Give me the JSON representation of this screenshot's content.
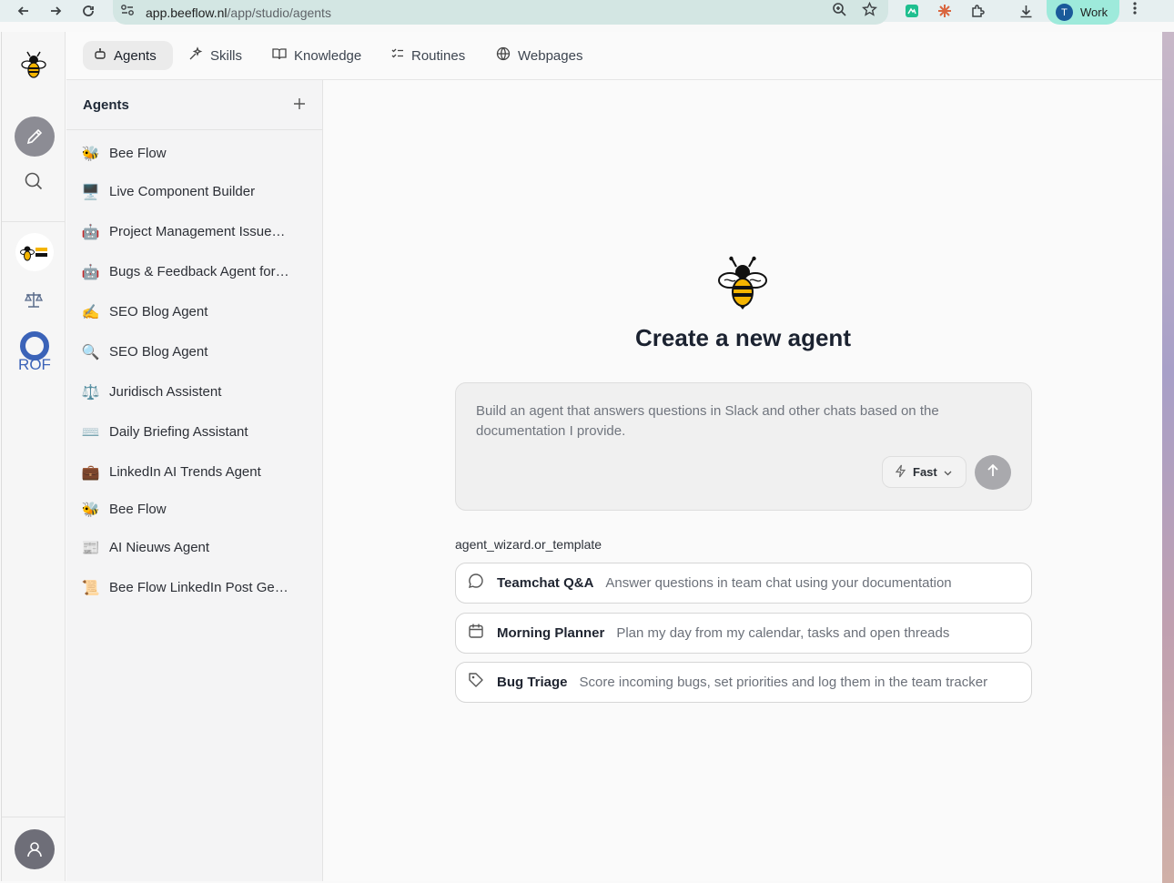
{
  "browser": {
    "url_host": "app.beeflow.nl",
    "url_path": "/app/studio/agents",
    "profile_initial": "T",
    "profile_label": "Work"
  },
  "tabs": [
    {
      "label": "Agents",
      "icon": "bot-icon",
      "active": true
    },
    {
      "label": "Skills",
      "icon": "sparkle-icon"
    },
    {
      "label": "Knowledge",
      "icon": "book-icon"
    },
    {
      "label": "Routines",
      "icon": "checklist-icon"
    },
    {
      "label": "Webpages",
      "icon": "globe-icon"
    }
  ],
  "agent_panel": {
    "title": "Agents",
    "items": [
      {
        "emoji": "🐝",
        "label": "Bee Flow"
      },
      {
        "emoji": "🖥️",
        "label": "Live Component Builder"
      },
      {
        "emoji": "🤖",
        "label": "Project Management Issue…"
      },
      {
        "emoji": "🤖",
        "label": "Bugs & Feedback Agent for…"
      },
      {
        "emoji": "✍️",
        "label": "SEO Blog Agent"
      },
      {
        "emoji": "🔍",
        "label": "SEO Blog Agent"
      },
      {
        "emoji": "⚖️",
        "label": "Juridisch Assistent"
      },
      {
        "emoji": "⌨️",
        "label": "Daily Briefing Assistant"
      },
      {
        "emoji": "💼",
        "label": "LinkedIn AI Trends Agent"
      },
      {
        "emoji": "🐝",
        "label": "Bee Flow"
      },
      {
        "emoji": "📰",
        "label": "AI Nieuws Agent"
      },
      {
        "emoji": "📜",
        "label": "Bee Flow LinkedIn Post Ge…"
      }
    ]
  },
  "main": {
    "title": "Create a new agent",
    "prompt_placeholder": "Build an agent that answers questions in Slack and other chats based on the documentation I provide.",
    "speed_label": "Fast",
    "section_label": "agent_wizard.or_template",
    "templates": [
      {
        "icon": "chat-bubble-icon",
        "name": "Teamchat Q&A",
        "desc": "Answer questions in team chat using your documentation"
      },
      {
        "icon": "calendar-icon",
        "name": "Morning Planner",
        "desc": "Plan my day from my calendar, tasks and open threads"
      },
      {
        "icon": "tag-icon",
        "name": "Bug Triage",
        "desc": "Score incoming bugs, set priorities and log them in the team tracker"
      }
    ]
  },
  "colors": {
    "accent_profile": "#9eeadb",
    "send_button": "#a9a9ad"
  }
}
